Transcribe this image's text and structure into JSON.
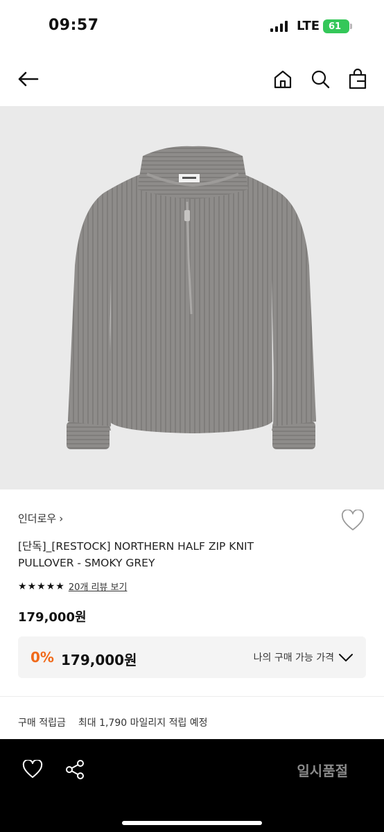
{
  "status_bar": {
    "time": "09:57",
    "network": "LTE",
    "battery": "61"
  },
  "nav": {
    "back_icon": "arrow-left-icon",
    "home_icon": "home-icon",
    "search_icon": "search-icon",
    "bag_icon": "shopping-bag-icon"
  },
  "product": {
    "brand": "인더로우",
    "brand_chevron": "›",
    "title": "[단독]_[RESTOCK] NORTHERN HALF ZIP KNIT PULLOVER - SMOKY GREY",
    "rating_stars": 5,
    "review_link": "20개 리뷰 보기",
    "price": "179,000원",
    "price_box": {
      "discount": "0%",
      "final_price": "179,000원",
      "my_price_label": "나의 구매 가능 가격"
    },
    "points": {
      "label": "구매 적립금",
      "value": "최대 1,790 마일리지 적립 예정"
    }
  },
  "bottom_bar": {
    "wish_icon": "heart-icon",
    "share_icon": "share-icon",
    "status_label": "일시품절"
  },
  "colors": {
    "accent": "#f06a1b",
    "sweater": "#8e8c8a",
    "bottom_bar": "#000000"
  }
}
